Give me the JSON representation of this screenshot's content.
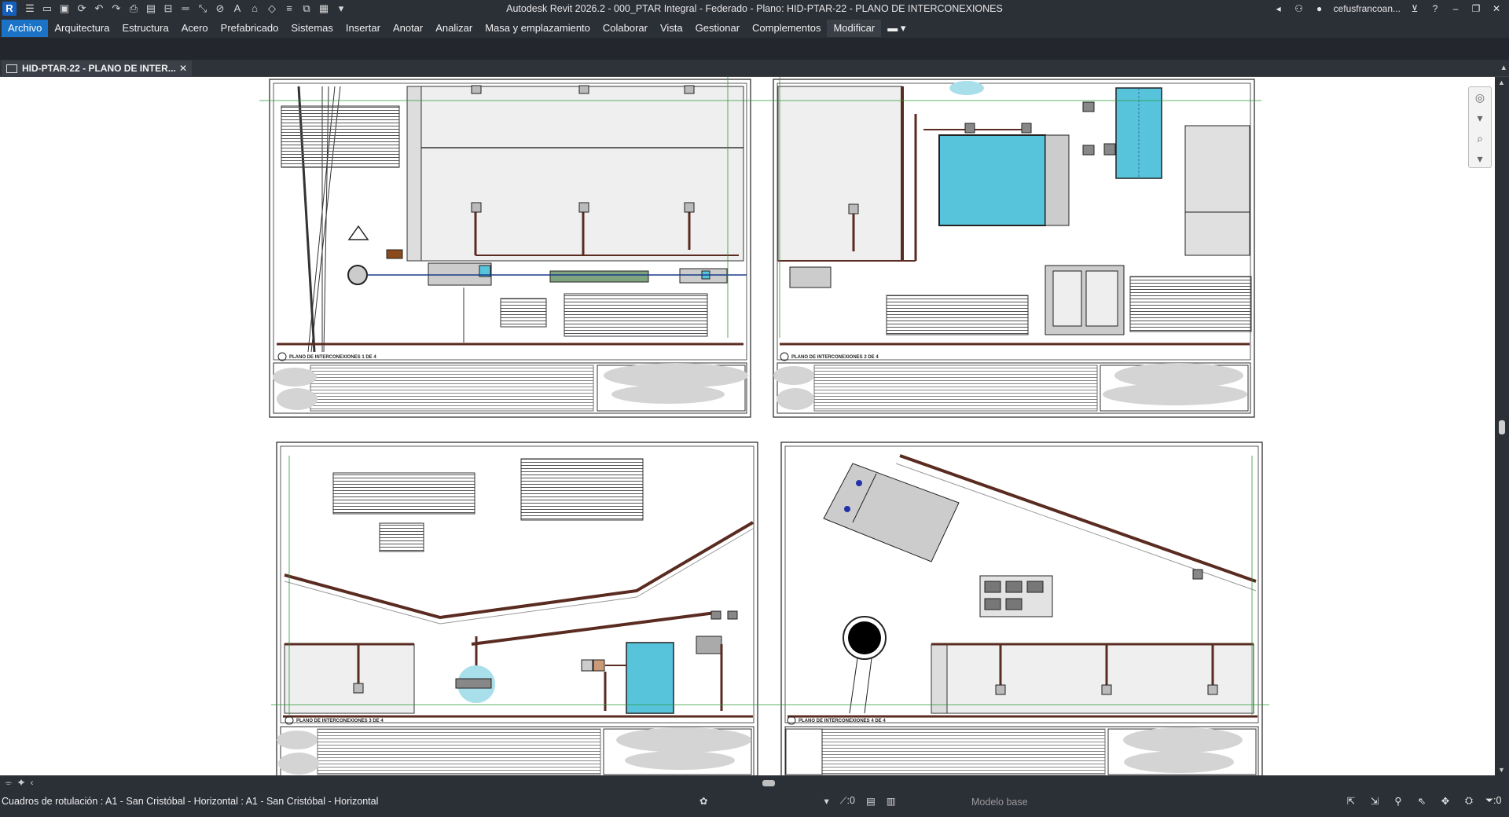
{
  "app": {
    "logo_letter": "R",
    "window_title": "Autodesk Revit 2026.2 - 000_PTAR Integral - Federado - Plano: HID-PTAR-22 - PLANO DE INTERCONEXIONES",
    "user": "cefusfrancoan...",
    "accent": "#1a73c6"
  },
  "quick_access": [
    "app-menu-icon",
    "open-icon",
    "save-icon",
    "sync-icon",
    "undo-icon",
    "redo-icon",
    "print-icon",
    "pdf-icon",
    "align-icon",
    "measure-icon",
    "dimension-icon",
    "text-icon",
    "home-icon",
    "tag-icon",
    "thin-lines-icon",
    "switch-windows-icon",
    "close-hidden-icon",
    "dropdown-icon"
  ],
  "menu": [
    "Arquitectura",
    "Estructura",
    "Acero",
    "Prefabricado",
    "Sistemas",
    "Insertar",
    "Anotar",
    "Analizar",
    "Masa y emplazamiento",
    "Colaborar",
    "Vista",
    "Gestionar",
    "Complementos",
    "Modificar"
  ],
  "menu_file": "Archivo",
  "menu_active": "Modificar",
  "tab": {
    "label": "HID-PTAR-22 - PLANO DE INTER...",
    "close": "✕"
  },
  "sheets": [
    {
      "label": "PLANO DE INTERCONEXIONES 1 DE 4"
    },
    {
      "label": "PLANO DE INTERCONEXIONES 2 DE 4"
    },
    {
      "label": "PLANO DE INTERCONEXIONES 3 DE 4"
    },
    {
      "label": "PLANO DE INTERCONEXIONES 4 DE 4"
    }
  ],
  "status": {
    "selection": "Cuadros de rotulación : A1 - San Cristóbal - Horizontal : A1 - San Cristóbal - Horizontal",
    "worksets": ":0",
    "model": "Modelo base",
    "filter_count": ":0"
  }
}
